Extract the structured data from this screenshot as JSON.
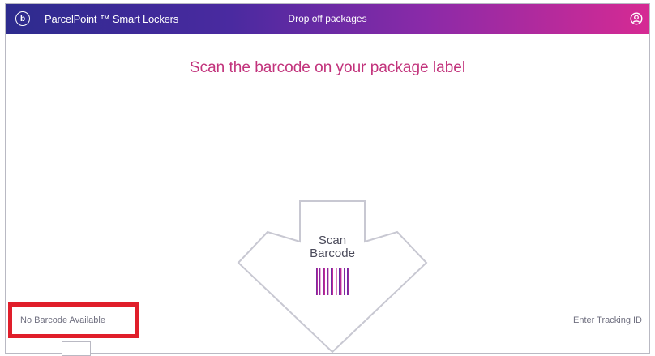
{
  "header": {
    "logo_letter": "b",
    "brand": "ParcelPoint ™ Smart Lockers",
    "title": "Drop off packages",
    "user_icon": "user-circle-icon"
  },
  "main": {
    "prompt": "Scan the barcode on your package label",
    "scan_button": {
      "line1": "Scan",
      "line2": "Barcode",
      "icon": "barcode-icon"
    },
    "no_barcode_link": "No Barcode Available",
    "enter_tracking_link": "Enter Tracking ID"
  },
  "colors": {
    "header_start": "#2d2b8e",
    "header_end": "#d62a93",
    "prompt": "#c2337c",
    "highlight_box": "#e01e2a"
  }
}
